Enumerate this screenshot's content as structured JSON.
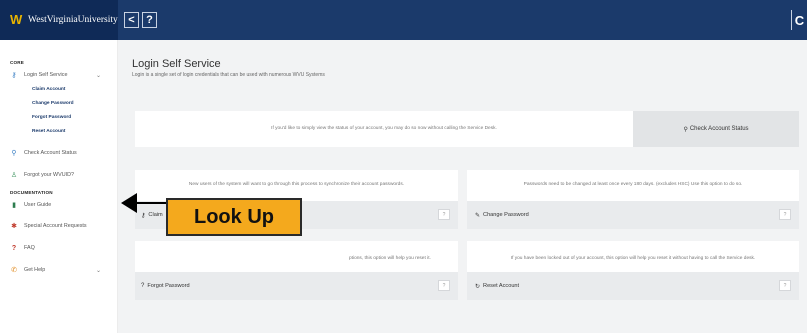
{
  "header": {
    "logo_text": "WestVirginiaUniversity",
    "back_label": "<",
    "help_label": "?",
    "right_label": "C"
  },
  "sidebar": {
    "core_label": "CORE",
    "login_self_service": "Login Self Service",
    "sub_items": [
      "Claim Account",
      "Change Password",
      "Forgot Password",
      "Reset Account"
    ],
    "check_account_status": "Check Account Status",
    "forgot_wvuid": "Forgot your WVUID?",
    "documentation_label": "DOCUMENTATION",
    "user_guide": "User Guide",
    "special_account_requests": "Special Account Requests",
    "faq": "FAQ",
    "get_help": "Get Help"
  },
  "main": {
    "title": "Login Self Service",
    "subtitle": "Login is a single set of login credentials that can be used with numerous WVU Systems",
    "status_text": "If you'd like to simply view the status of your account, you may do so now without calling the Service Desk.",
    "status_button": "Check Account Status",
    "claim_text": "New users of the system will want to go through this process to synchronize their account passwords.",
    "claim_label": "Claim",
    "change_text": "Passwords need to be changed at least once every 180 days. (excludes HSC) Use this option to do so.",
    "change_label": "Change Password",
    "forgot_text": "ptions, this option will help you reset it.",
    "forgot_label": "Forgot Password",
    "reset_text": "If you have been locked out of your account, this option will help you reset it without having to call the Service desk.",
    "reset_label": "Reset Account",
    "q_label": "?"
  },
  "callout": {
    "label": "Look Up"
  }
}
